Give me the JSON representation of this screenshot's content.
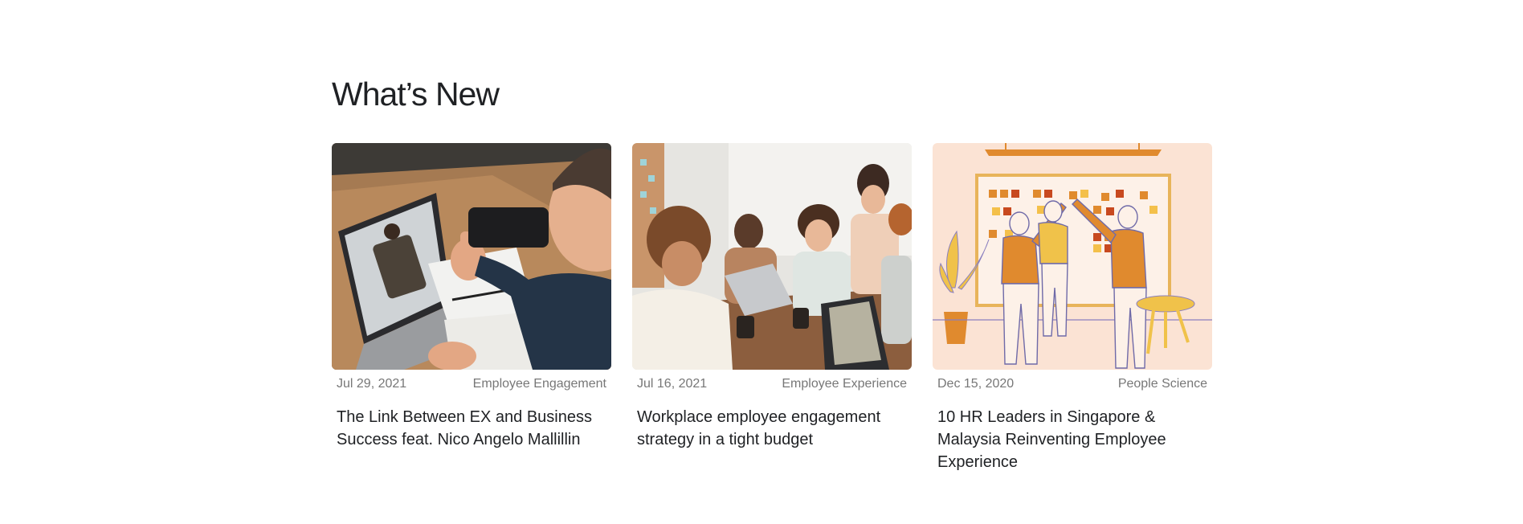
{
  "section": {
    "title": "What’s New"
  },
  "cards": [
    {
      "date": "Jul 29, 2021",
      "category": "Employee Engagement",
      "title": "The Link Between EX and Business Success feat. Nico Angelo Mallillin",
      "image_icon": "video-call-photo"
    },
    {
      "date": "Jul 16, 2021",
      "category": "Employee Experience",
      "title": "Workplace employee engagement strategy in a tight budget",
      "image_icon": "team-meeting-photo"
    },
    {
      "date": "Dec 15, 2020",
      "category": "People Science",
      "title": "10 HR Leaders in Singapore & Malaysia Reinventing Employee Experience",
      "image_icon": "high-five-illustration"
    }
  ],
  "colors": {
    "heading": "#1f2124",
    "meta": "#777777",
    "illustration_bg": "#fbe3d4",
    "accent_orange": "#e08a2e"
  }
}
